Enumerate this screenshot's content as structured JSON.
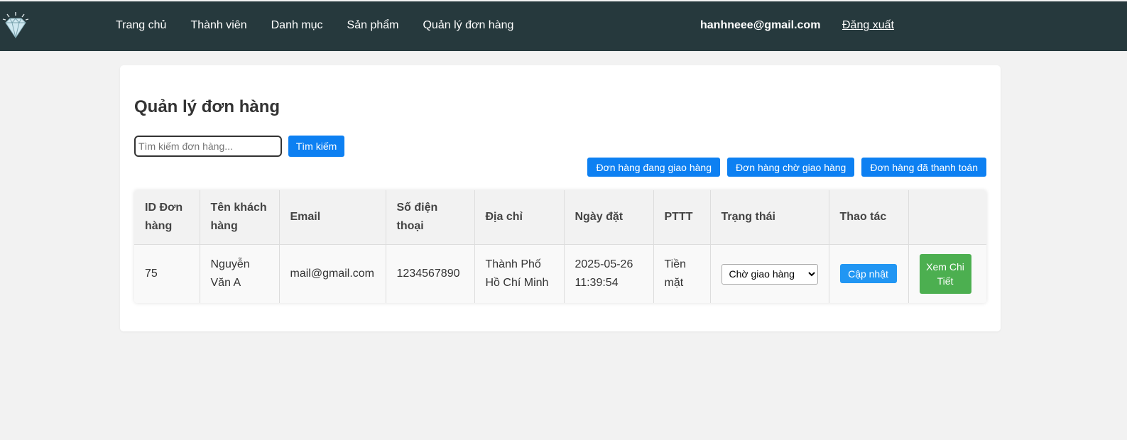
{
  "nav": {
    "items": [
      "Trang chủ",
      "Thành viên",
      "Danh mục",
      "Sản phẩm",
      "Quản lý đơn hàng"
    ],
    "user_email": "hanhneee@gmail.com",
    "logout": "Đăng xuất"
  },
  "page": {
    "title": "Quản lý đơn hàng",
    "search_placeholder": "Tìm kiếm đơn hàng...",
    "search_button": "Tìm kiếm",
    "filters": [
      "Đơn hàng đang giao hàng",
      "Đơn hàng chờ giao hàng",
      "Đơn hàng đã thanh toán"
    ]
  },
  "table": {
    "headers": [
      "ID Đơn hàng",
      "Tên khách hàng",
      "Email",
      "Số điện thoại",
      "Địa chỉ",
      "Ngày đặt",
      "PTTT",
      "Trạng thái",
      "Thao tác",
      ""
    ],
    "rows": [
      {
        "id": "75",
        "name": "Nguyễn Văn A",
        "email": "mail@gmail.com",
        "phone": "1234567890",
        "address": "Thành Phố Hồ Chí Minh",
        "date": "2025-05-26 11:39:54",
        "payment": "Tiền mặt",
        "status": "Chờ giao hàng",
        "update_label": "Cập nhật",
        "detail_label": "Xem Chi Tiết"
      }
    ]
  },
  "colors": {
    "topbar": "#26393d",
    "primary": "#0d80f2",
    "update": "#2196f3",
    "detail": "#4caf50"
  },
  "icons": {
    "logo": "diamond-icon"
  }
}
